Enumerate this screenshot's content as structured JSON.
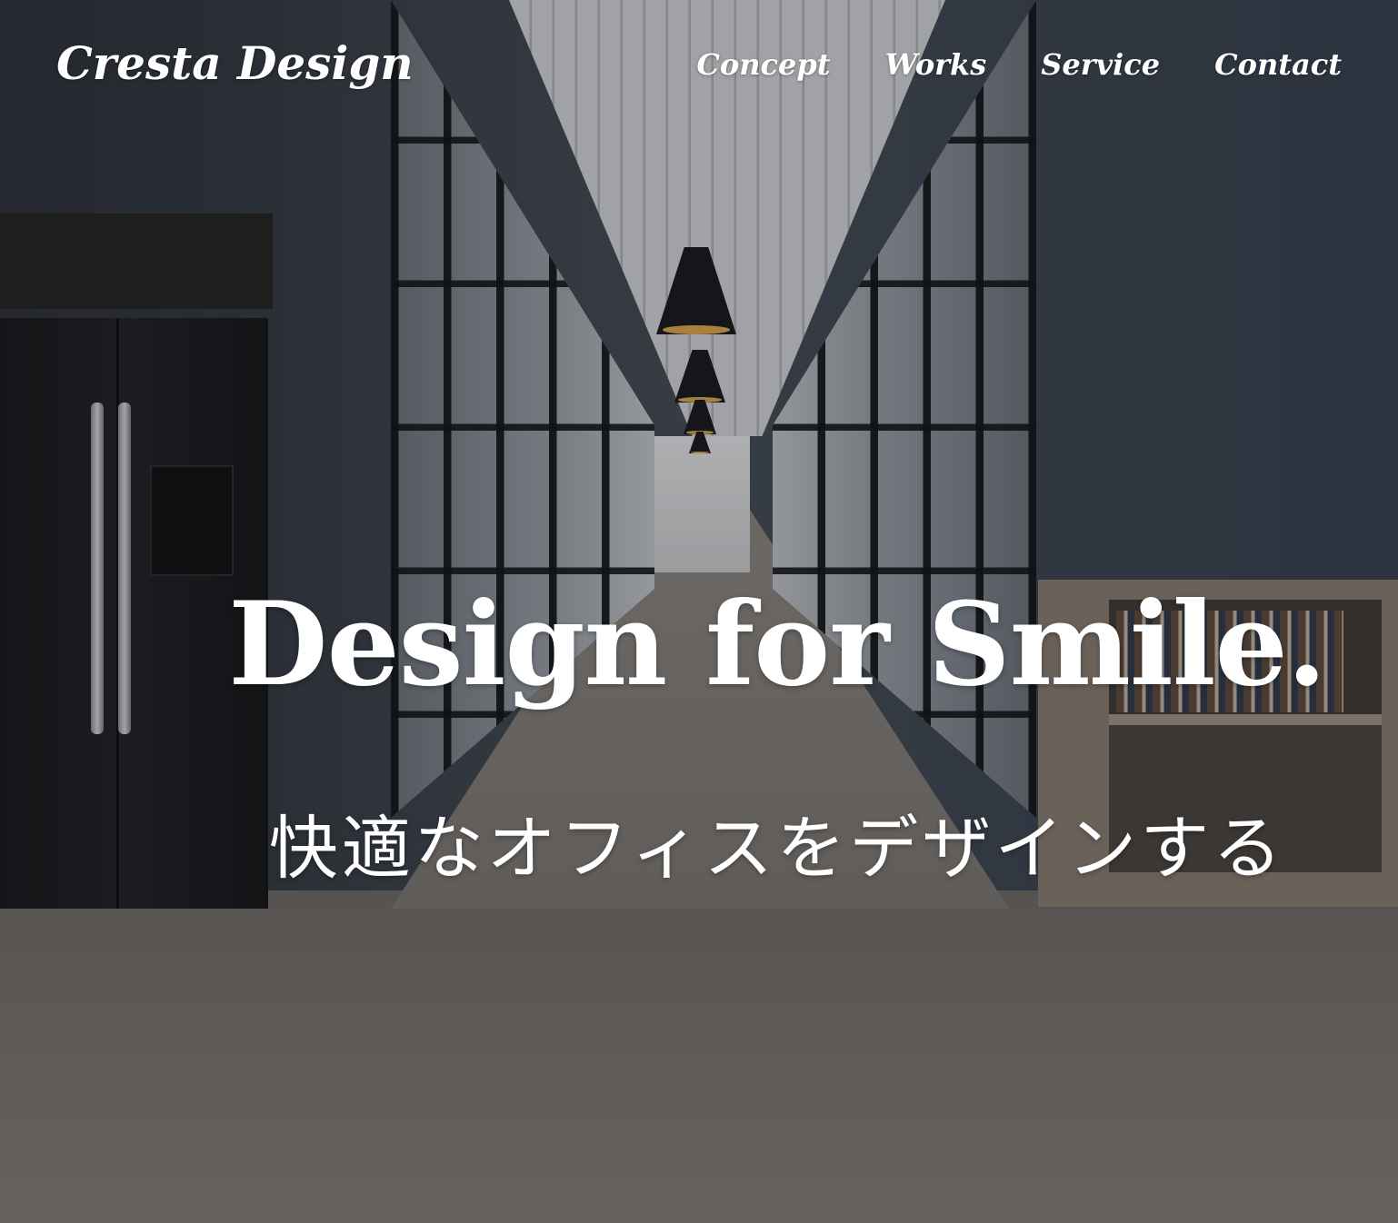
{
  "header": {
    "logo": "Cresta Design",
    "nav": [
      {
        "label": "Concept"
      },
      {
        "label": "Works"
      },
      {
        "label": "Service"
      },
      {
        "label": "Contact"
      }
    ]
  },
  "hero": {
    "headline": "Design for Smile.",
    "subheadline": "快適なオフィスをデザインする"
  },
  "colors": {
    "text": "#ffffff"
  }
}
